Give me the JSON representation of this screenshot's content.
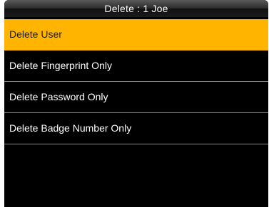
{
  "header": {
    "title": "Delete : 1 Joe"
  },
  "menu": {
    "items": [
      {
        "label": "Delete User",
        "selected": true
      },
      {
        "label": "Delete Fingerprint Only",
        "selected": false
      },
      {
        "label": "Delete Password Only",
        "selected": false
      },
      {
        "label": "Delete Badge Number Only",
        "selected": false
      }
    ]
  },
  "colors": {
    "screen_background": "#000000",
    "selection_highlight": "#ffb400",
    "divider": "#8a8a8a",
    "text": "#ffffff"
  }
}
